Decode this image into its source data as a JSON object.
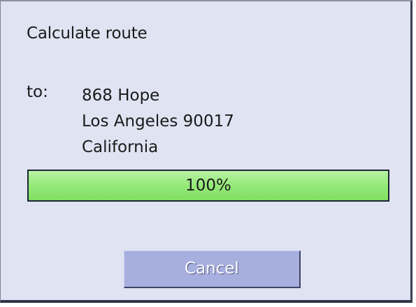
{
  "dialog": {
    "title": "Calculate route",
    "to_label": "to:",
    "address": [
      "868 Hope",
      "Los Angeles 90017",
      "California"
    ]
  },
  "progress": {
    "value_fraction": 1.0,
    "label": "100%",
    "fill_color": "#98ea7c"
  },
  "buttons": {
    "cancel_label": "Cancel"
  }
}
